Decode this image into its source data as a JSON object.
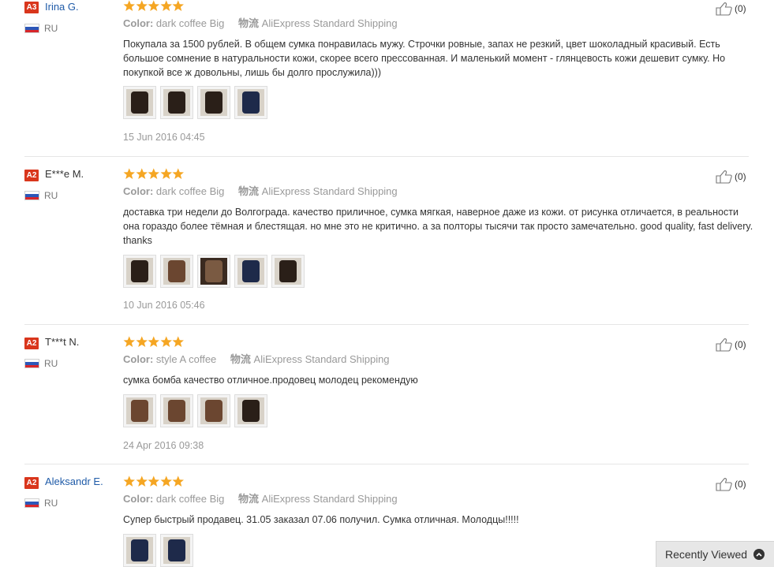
{
  "reviews": [
    {
      "level": "A3",
      "name": "Irina G.",
      "country": "RU",
      "rating": 5,
      "color_label": "Color:",
      "color_value": "dark coffee Big",
      "shipping_label": "物流",
      "shipping_value": "AliExpress Standard Shipping",
      "text": "Покупала за 1500 рублей. В общем сумка понравилась мужу. Строчки ровные, запах не резкий, цвет шоколадный красивый. Есть большое сомнение в натуральности кожи, скорее всего прессованная. И маленький момент - глянцевость кожи дешевит сумку. Но покупкой все ж довольны, лишь бы долго прослужила)))",
      "photo_count": 4,
      "date": "15 Jun 2016 04:45",
      "helpful": "(0)"
    },
    {
      "level": "A2",
      "name": "E***e M.",
      "country": "RU",
      "rating": 5,
      "color_label": "Color:",
      "color_value": "dark coffee Big",
      "shipping_label": "物流",
      "shipping_value": "AliExpress Standard Shipping",
      "text": "доставка три недели до Волгограда. качество приличное, сумка мягкая, наверное даже из кожи. от рисунка отличается, в реальности она гораздо более тёмная и блестящая. но мне это не критично. а за полторы тысячи так просто замечательно. good quality, fast delivery. thanks",
      "photo_count": 5,
      "date": "10 Jun 2016 05:46",
      "helpful": "(0)"
    },
    {
      "level": "A2",
      "name": "T***t N.",
      "country": "RU",
      "rating": 5,
      "color_label": "Color:",
      "color_value": "style A coffee",
      "shipping_label": "物流",
      "shipping_value": "AliExpress Standard Shipping",
      "text": "сумка бомба качество отличное.продовец молодец рекомендую",
      "photo_count": 4,
      "date": "24 Apr 2016 09:38",
      "helpful": "(0)"
    },
    {
      "level": "A2",
      "name": "Aleksandr E.",
      "country": "RU",
      "rating": 5,
      "color_label": "Color:",
      "color_value": "dark coffee Big",
      "shipping_label": "物流",
      "shipping_value": "AliExpress Standard Shipping",
      "text": "Супер быстрый продавец. 31.05 заказал 07.06 получил. Сумка отличная. Молодцы!!!!!",
      "photo_count": 2,
      "date": "",
      "helpful": "(0)"
    }
  ],
  "recently_viewed": {
    "label": "Recently Viewed"
  },
  "colors": {
    "star": "#f5a623",
    "badge": "#d9361c",
    "link": "#1f5ba8"
  }
}
